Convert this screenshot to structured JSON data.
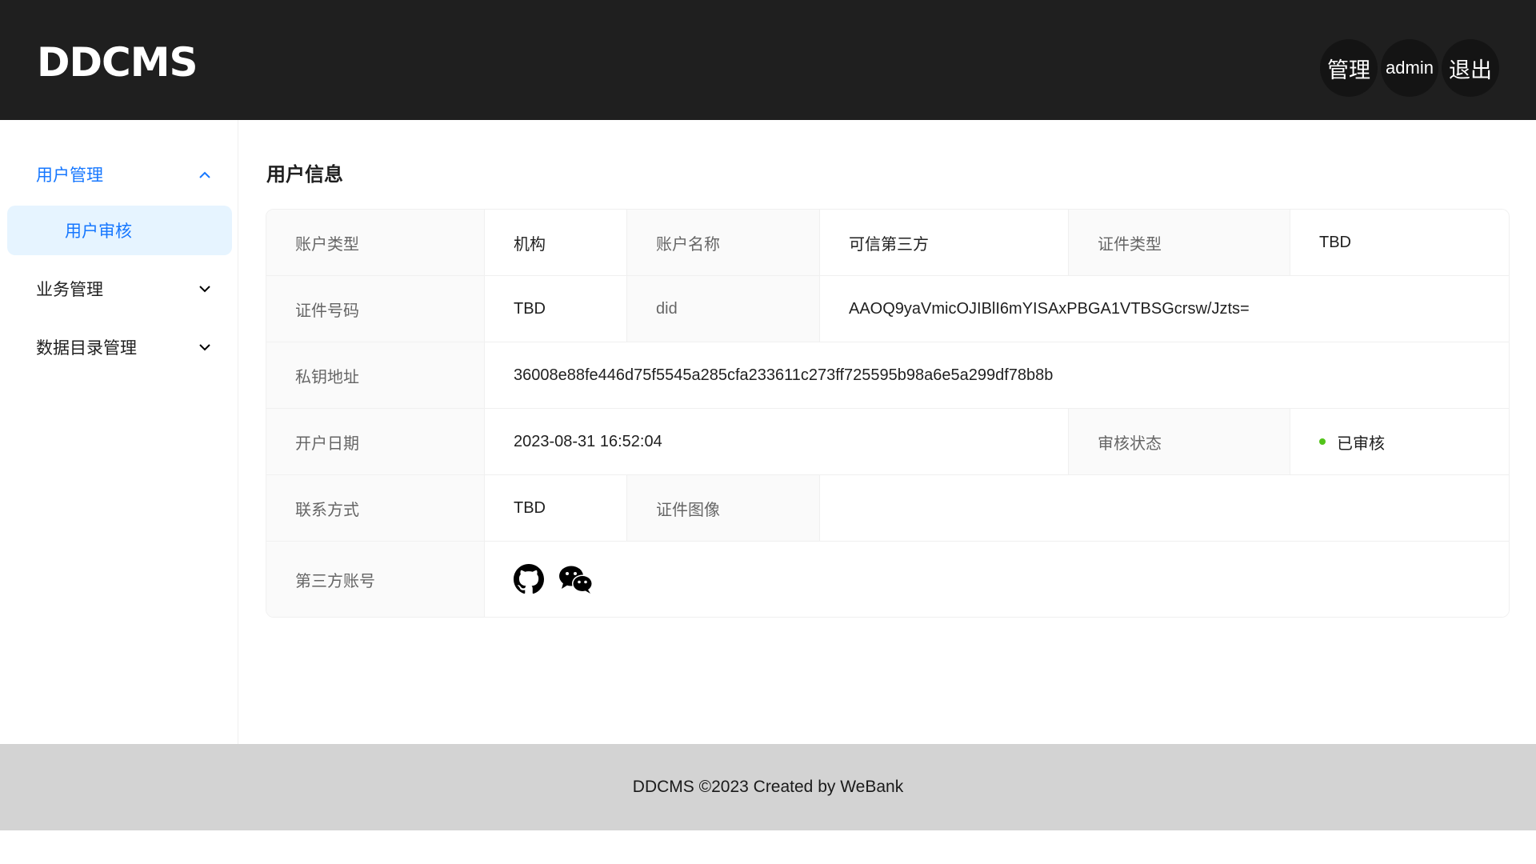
{
  "header": {
    "logo": "DDCMS",
    "actions": [
      {
        "label": "管理"
      },
      {
        "label": "admin"
      },
      {
        "label": "退出"
      }
    ]
  },
  "sidebar": {
    "items": [
      {
        "label": "用户管理",
        "expanded": true,
        "children": [
          {
            "label": "用户审核",
            "selected": true
          }
        ]
      },
      {
        "label": "业务管理",
        "expanded": false
      },
      {
        "label": "数据目录管理",
        "expanded": false
      }
    ]
  },
  "main": {
    "title": "用户信息",
    "fields": {
      "account_type": {
        "label": "账户类型",
        "value": "机构"
      },
      "account_name": {
        "label": "账户名称",
        "value": "可信第三方"
      },
      "cert_type": {
        "label": "证件类型",
        "value": "TBD"
      },
      "cert_number": {
        "label": "证件号码",
        "value": "TBD"
      },
      "did": {
        "label": "did",
        "value": "AAOQ9yaVmicOJIBlI6mYISAxPBGA1VTBSGcrsw/Jzts="
      },
      "private_key": {
        "label": "私钥地址",
        "value": "36008e88fe446d75f5545a285cfa233611c273ff725595b98a6e5a299df78b8b"
      },
      "open_date": {
        "label": "开户日期",
        "value": "2023-08-31 16:52:04"
      },
      "review_status": {
        "label": "审核状态",
        "value": "已审核",
        "color": "#52c41a"
      },
      "contact": {
        "label": "联系方式",
        "value": "TBD"
      },
      "cert_image": {
        "label": "证件图像",
        "value": ""
      },
      "third_party": {
        "label": "第三方账号",
        "icons": [
          "github-icon",
          "wechat-icon"
        ]
      }
    }
  },
  "footer": {
    "text": "DDCMS ©2023 Created by WeBank"
  },
  "colors": {
    "header_bg": "#1f1f1f",
    "accent": "#1677ff",
    "selected_bg": "#e6f4ff",
    "footer_bg": "#d3d3d3",
    "status_ok": "#52c41a"
  }
}
